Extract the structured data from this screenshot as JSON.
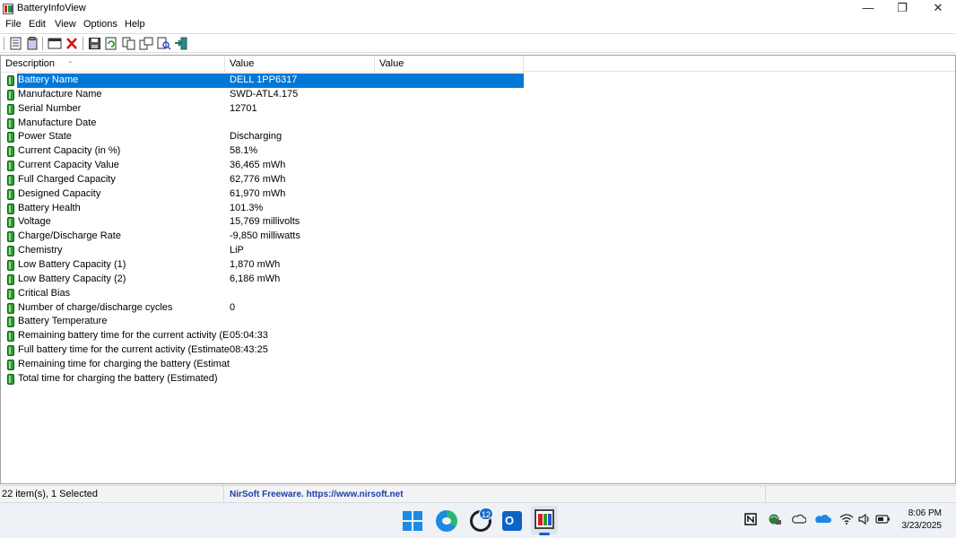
{
  "window": {
    "title": "BatteryInfoView",
    "minimize_glyph": "—",
    "maximize_glyph": "❐",
    "close_glyph": "✕"
  },
  "menu": [
    "File",
    "Edit",
    "View",
    "Options",
    "Help"
  ],
  "toolbar_icons": [
    "properties-icon",
    "copy-icon",
    "window-icon",
    "delete-icon",
    "save-icon",
    "refresh-icon",
    "copy-selected-icon",
    "html-report-icon",
    "find-icon",
    "exit-icon"
  ],
  "columns": {
    "description": "Description",
    "value": "Value",
    "value2": "Value",
    "sort_indicator": "⌃"
  },
  "rows": [
    {
      "desc": "Battery Name",
      "val": "DELL 1PP6317",
      "selected": true
    },
    {
      "desc": "Manufacture Name",
      "val": "SWD-ATL4.175"
    },
    {
      "desc": "Serial Number",
      "val": "12701"
    },
    {
      "desc": "Manufacture Date",
      "val": ""
    },
    {
      "desc": "Power State",
      "val": "Discharging"
    },
    {
      "desc": "Current Capacity (in %)",
      "val": "58.1%"
    },
    {
      "desc": "Current Capacity Value",
      "val": "36,465 mWh"
    },
    {
      "desc": "Full Charged Capacity",
      "val": "62,776 mWh"
    },
    {
      "desc": "Designed Capacity",
      "val": "61,970 mWh"
    },
    {
      "desc": "Battery Health",
      "val": "101.3%"
    },
    {
      "desc": "Voltage",
      "val": "15,769 millivolts"
    },
    {
      "desc": "Charge/Discharge Rate",
      "val": "-9,850 milliwatts"
    },
    {
      "desc": "Chemistry",
      "val": "LiP"
    },
    {
      "desc": "Low Battery Capacity (1)",
      "val": "1,870 mWh"
    },
    {
      "desc": "Low Battery Capacity (2)",
      "val": "6,186 mWh"
    },
    {
      "desc": "Critical Bias",
      "val": ""
    },
    {
      "desc": "Number of charge/discharge cycles",
      "val": "0"
    },
    {
      "desc": "Battery Temperature",
      "val": ""
    },
    {
      "desc": "Remaining battery time for the current activity (Est...",
      "val": "05:04:33"
    },
    {
      "desc": "Full battery time for the current activity (Estimated)",
      "val": "08:43:25"
    },
    {
      "desc": "Remaining time for charging the battery (Estimated)",
      "val": ""
    },
    {
      "desc": "Total  time for charging the battery (Estimated)",
      "val": ""
    }
  ],
  "status": {
    "count": "22 item(s), 1 Selected",
    "link": "NirSoft Freeware. https://www.nirsoft.net"
  },
  "taskbar": {
    "whatsapp_badge": "12",
    "clock_time": "8:06 PM",
    "clock_date": "3/23/2025",
    "tray_icons": [
      "notion-icon",
      "network-globe-icon",
      "cloud-icon",
      "onedrive-icon",
      "wifi-icon",
      "volume-icon",
      "battery-icon"
    ]
  }
}
